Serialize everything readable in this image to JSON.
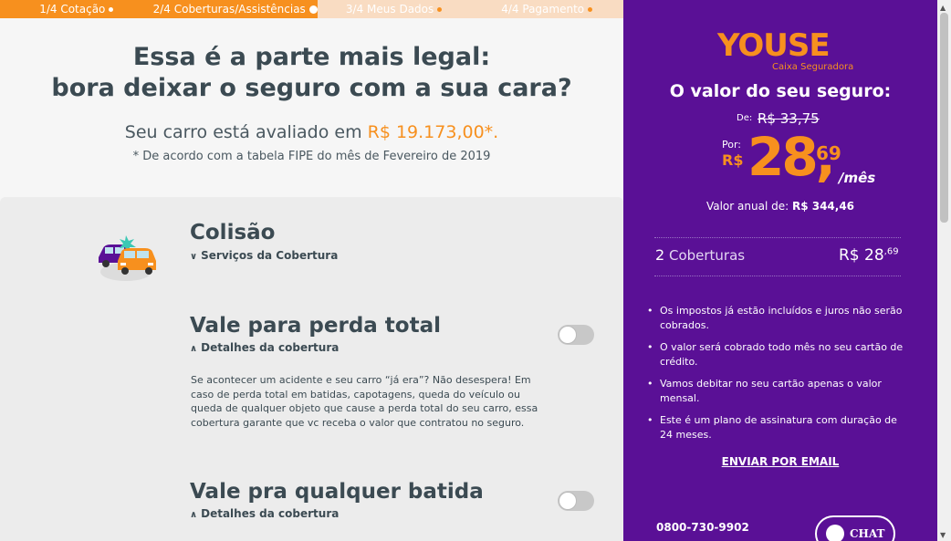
{
  "steps": [
    {
      "label": "1/4 Cotação"
    },
    {
      "label": "2/4 Coberturas/Assistências"
    },
    {
      "label": "3/4 Meus Dados"
    },
    {
      "label": "4/4 Pagamento"
    }
  ],
  "hero": {
    "title_line1": "Essa é a parte mais legal:",
    "title_line2": "bora deixar o seguro com a sua cara?",
    "sub_prefix": "Seu carro está avaliado em ",
    "sub_price": "R$ 19.173,00*.",
    "note": "* De acordo com a tabela FIPE do mês de Fevereiro de 2019"
  },
  "coverages": [
    {
      "title": "Colisão",
      "toggle_label": "Serviços da Cobertura"
    },
    {
      "title": "Vale para perda total",
      "toggle_label": "Detalhes da cobertura",
      "description": "Se acontecer um acidente e seu carro “já era”? Não desespera! Em caso de perda total em batidas, capotagens, queda do veículo ou queda de qualquer objeto que cause a perda total do seu carro, essa cobertura garante que vc receba o valor que contratou no seguro."
    },
    {
      "title": "Vale pra qualquer batida",
      "toggle_label": "Detalhes da cobertura"
    }
  ],
  "summary": {
    "logo_text": "YOUSE",
    "logo_sub": "Caixa Seguradora",
    "title": "O valor do seu seguro:",
    "de_label": "De:",
    "de_value": "R$ 33,75",
    "por_label": "Por:",
    "currency": "R$",
    "price_int": "28,",
    "price_cents": "69",
    "per_month": "/mês",
    "annual_label": "Valor anual de: ",
    "annual_value": "R$ 344,46",
    "cov_count": "2",
    "cov_label": "Coberturas",
    "cov_price": "R$ 28",
    "cov_price_cents": ",69",
    "bullets": [
      "Os impostos já estão incluídos e juros não serão cobrados.",
      "O valor será cobrado todo mês no seu cartão de crédito.",
      "Vamos debitar no seu cartão apenas o valor mensal.",
      "Este é um plano de assinatura com duração de 24 meses."
    ],
    "email_link": "ENVIAR POR EMAIL",
    "phone": "0800-730-9902",
    "chat_label": "CHAT"
  },
  "colors": {
    "orange": "#f7901e",
    "purple": "#5a1096"
  }
}
